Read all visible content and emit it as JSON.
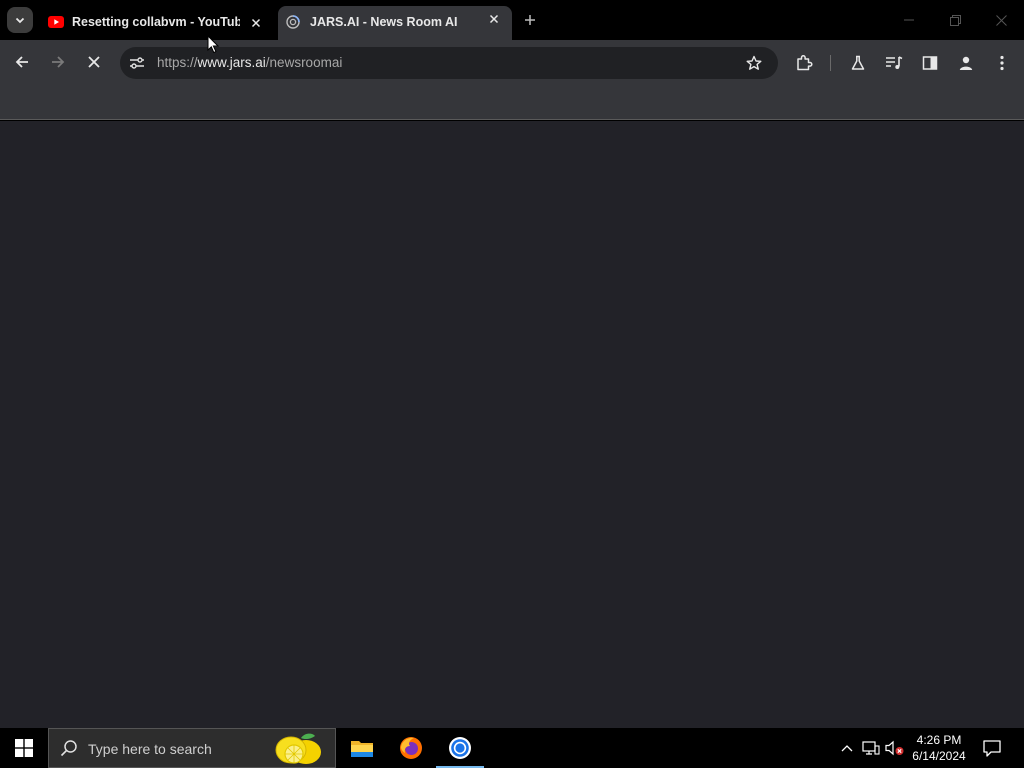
{
  "tabs": [
    {
      "title": "Resetting collabvm - YouTube",
      "favicon": "youtube-icon",
      "active": false
    },
    {
      "title": "JARS.AI - News Room AI",
      "favicon": "globe-loading-icon",
      "active": true
    }
  ],
  "address_bar": {
    "scheme": "https://",
    "host": "www.jars.ai",
    "path": "/newsroomai"
  },
  "taskbar": {
    "search_placeholder": "Type here to search",
    "apps": [
      "file-explorer-icon",
      "firefox-icon",
      "chrome-icon"
    ],
    "clock": {
      "time": "4:26 PM",
      "date": "6/14/2024"
    }
  },
  "colors": {
    "content_bg": "#222228",
    "toolbar_bg": "#35363a",
    "tab_strip_bg": "#000000",
    "youtube_red": "#ff0000",
    "chrome_blue": "#1a73e8"
  }
}
